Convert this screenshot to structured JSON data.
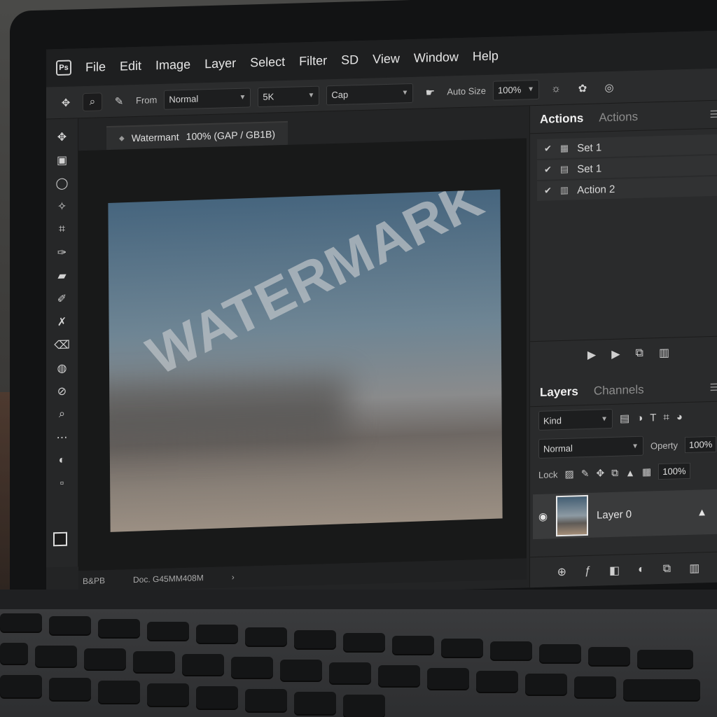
{
  "menu": {
    "items": [
      "File",
      "Edit",
      "Image",
      "Layer",
      "Select",
      "Filter",
      "SD",
      "View",
      "Window",
      "Help"
    ]
  },
  "options": {
    "from_label": "From",
    "mode_value": "Normal",
    "size_value": "5K",
    "cap_value": "Cap",
    "auto_size_label": "Auto Size",
    "zoom_value": "100%"
  },
  "document": {
    "tab_title": "Watermant",
    "tab_info": "100% (GAP / GB1B)",
    "watermark_text": "WATERMARK"
  },
  "status": {
    "left": "B&PB",
    "doc": "Doc. G45MM408M",
    "arrow": "›"
  },
  "actions_panel": {
    "tab_active": "Actions",
    "tab_inactive": "Actions",
    "rows": [
      {
        "label": "Set 1"
      },
      {
        "label": "Set 1"
      },
      {
        "label": "Action 2"
      }
    ]
  },
  "layers_panel": {
    "tab_active": "Layers",
    "tab_inactive": "Channels",
    "kind_label": "Kind",
    "blend_mode": "Normal",
    "opacity_label": "Operty",
    "opacity_value": "100%",
    "lock_label": "Lock",
    "fill_value": "100%",
    "layer_name": "Layer 0"
  },
  "colors": {
    "app_bg": "#232425",
    "panel_bg": "#2a2b2c",
    "accent_text": "#f0f0f0"
  }
}
